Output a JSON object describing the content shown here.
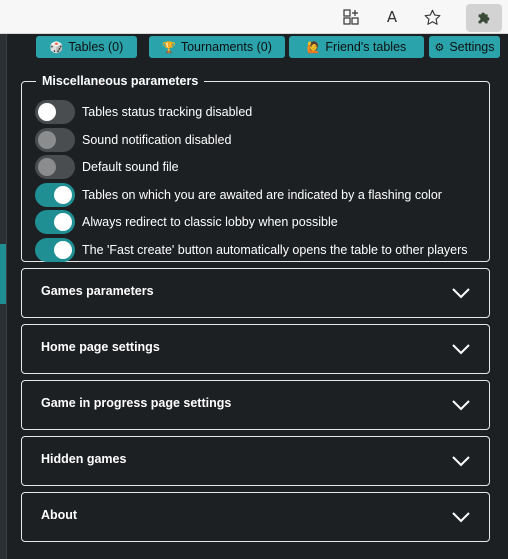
{
  "browser": {
    "icons": [
      "apps-add-icon",
      "read-aloud-icon",
      "favorite-star-icon",
      "extension-puzzle-icon"
    ],
    "read_aloud_glyph": "A⁾",
    "read_aloud_text": "A"
  },
  "nav": {
    "tables": {
      "icon": "🎲",
      "label": "Tables (0)"
    },
    "tournaments": {
      "icon": "🏆",
      "label": "Tournaments (0)"
    },
    "friends": {
      "icon": "🙋",
      "label": "Friend's tables"
    },
    "settings": {
      "icon": "⚙",
      "label": "Settings"
    }
  },
  "misc": {
    "title": "Miscellaneous parameters",
    "options": [
      {
        "label": "Tables status tracking disabled",
        "on": false
      },
      {
        "label": "Sound notification disabled",
        "on": false
      },
      {
        "label": "Default sound file",
        "on": false
      },
      {
        "label": "Tables on which you are awaited are indicated by a flashing color",
        "on": true
      },
      {
        "label": "Always redirect to classic lobby when possible",
        "on": true
      },
      {
        "label": "The 'Fast create' button automatically opens the table to other players",
        "on": true
      }
    ]
  },
  "sections": [
    {
      "title": "Games parameters"
    },
    {
      "title": "Home page settings"
    },
    {
      "title": "Game in progress page settings"
    },
    {
      "title": "Hidden games"
    },
    {
      "title": "About"
    }
  ],
  "colors": {
    "accent": "#2aa3ab",
    "toggle_on": "#1f8f94",
    "background": "#1d2023",
    "border": "#e8e8e8"
  }
}
